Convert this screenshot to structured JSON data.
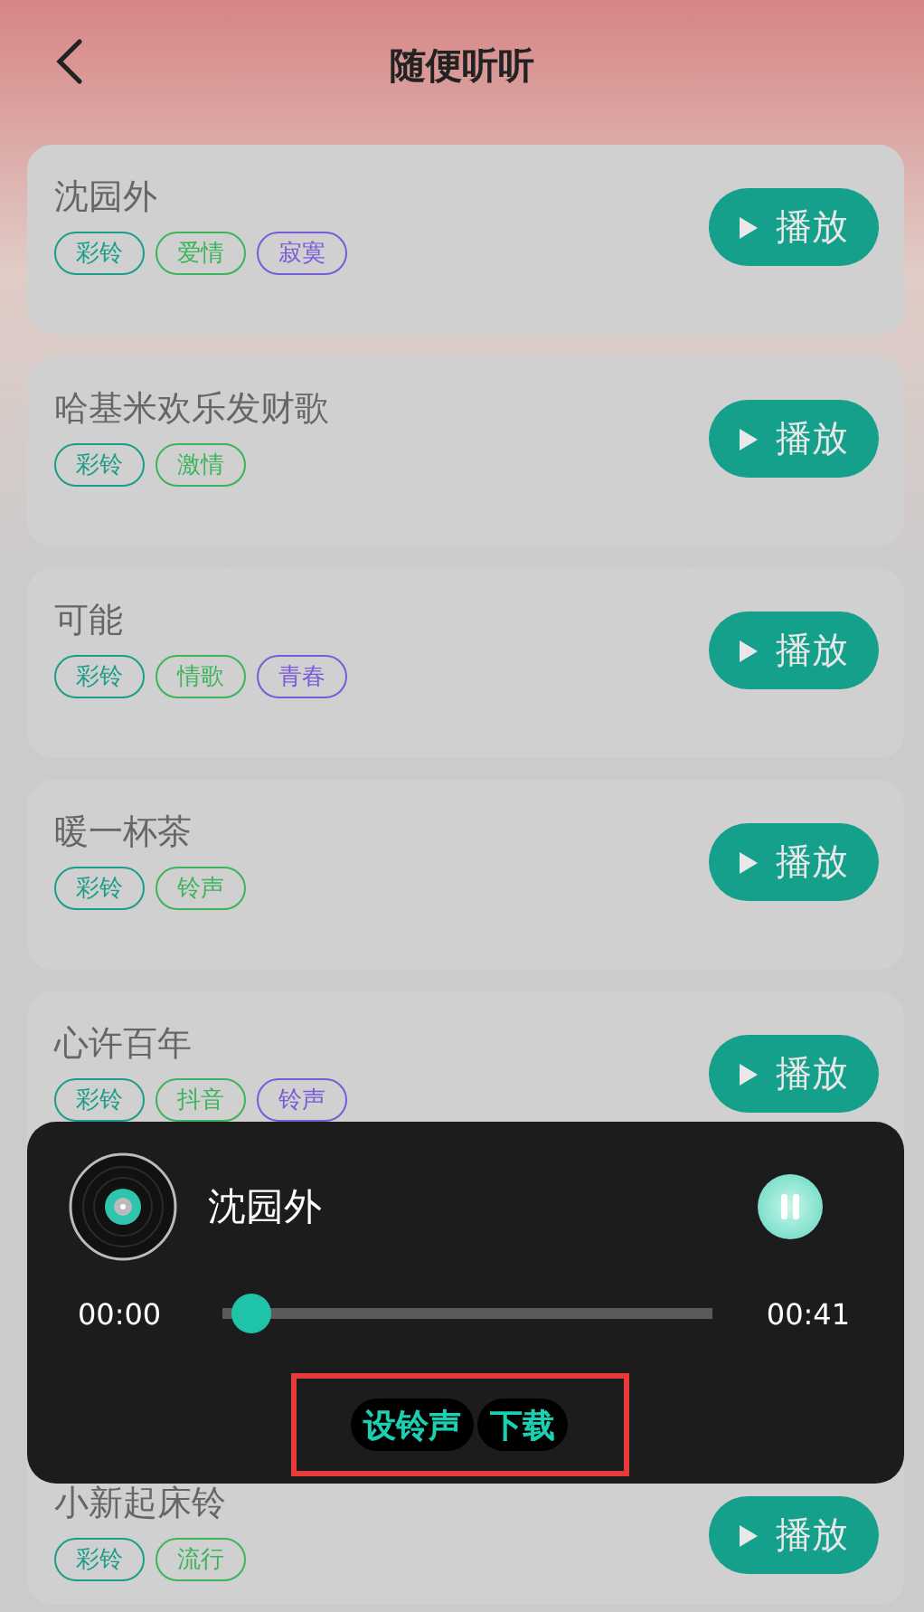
{
  "header": {
    "title": "随便听听"
  },
  "songs": [
    {
      "title": "沈园外",
      "tags": [
        {
          "label": "彩铃",
          "color": "#1a9e88"
        },
        {
          "label": "爱情",
          "color": "#3cb45a"
        },
        {
          "label": "寂寞",
          "color": "#7a5ad8"
        }
      ],
      "button": "播放"
    },
    {
      "title": "哈基米欢乐发财歌",
      "tags": [
        {
          "label": "彩铃",
          "color": "#1a9e88"
        },
        {
          "label": "激情",
          "color": "#3cb45a"
        }
      ],
      "button": "播放"
    },
    {
      "title": "可能",
      "tags": [
        {
          "label": "彩铃",
          "color": "#1a9e88"
        },
        {
          "label": "情歌",
          "color": "#3cb45a"
        },
        {
          "label": "青春",
          "color": "#7a5ad8"
        }
      ],
      "button": "播放"
    },
    {
      "title": "暖一杯茶",
      "tags": [
        {
          "label": "彩铃",
          "color": "#1a9e88"
        },
        {
          "label": "铃声",
          "color": "#3cb45a"
        }
      ],
      "button": "播放"
    },
    {
      "title": "心许百年",
      "tags": [
        {
          "label": "彩铃",
          "color": "#1a9e88"
        },
        {
          "label": "抖音",
          "color": "#3cb45a"
        },
        {
          "label": "铃声",
          "color": "#7a5ad8"
        }
      ],
      "button": "播放"
    },
    {
      "kind": "hidden"
    },
    {
      "title": "小新起床铃",
      "tags": [
        {
          "label": "彩铃",
          "color": "#1a9e88"
        },
        {
          "label": "流行",
          "color": "#3cb45a"
        }
      ],
      "button": "播放"
    }
  ],
  "player": {
    "title": "沈园外",
    "playing": true,
    "elapsed": "00:00",
    "duration": "00:41",
    "level": 0.02,
    "actions": [
      "设铃声",
      "下载"
    ]
  }
}
